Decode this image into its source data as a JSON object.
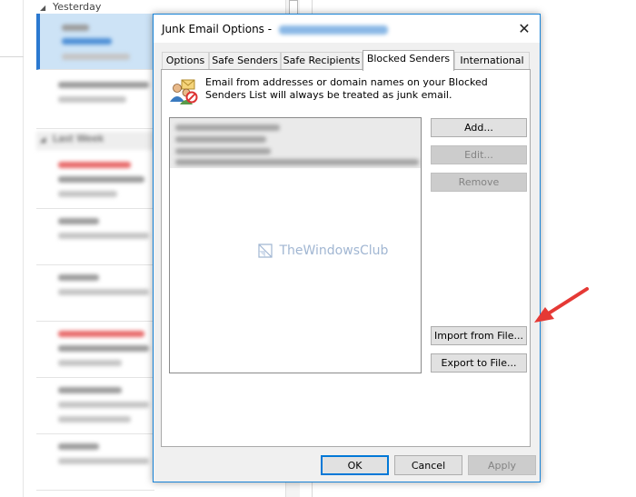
{
  "background": {
    "group_yesterday": "Yesterday",
    "group_last_week": "Last Week"
  },
  "dialog": {
    "title": "Junk Email Options - ",
    "close_glyph": "✕",
    "tabs": [
      {
        "label": "Options"
      },
      {
        "label": "Safe Senders"
      },
      {
        "label": "Safe Recipients"
      },
      {
        "label": "Blocked Senders"
      },
      {
        "label": "International"
      }
    ],
    "active_tab": "Blocked Senders",
    "description": "Email from addresses or domain names on your Blocked Senders List will always be treated as junk email.",
    "side_buttons": {
      "add": "Add...",
      "edit": "Edit...",
      "remove": "Remove",
      "import": "Import from File...",
      "export": "Export to File..."
    },
    "footer_buttons": {
      "ok": "OK",
      "cancel": "Cancel",
      "apply": "Apply"
    },
    "watermark": "TheWindowsClub"
  },
  "colors": {
    "accent": "#0078d7",
    "arrow": "#e53935",
    "selected_item": "#cde3f6"
  }
}
